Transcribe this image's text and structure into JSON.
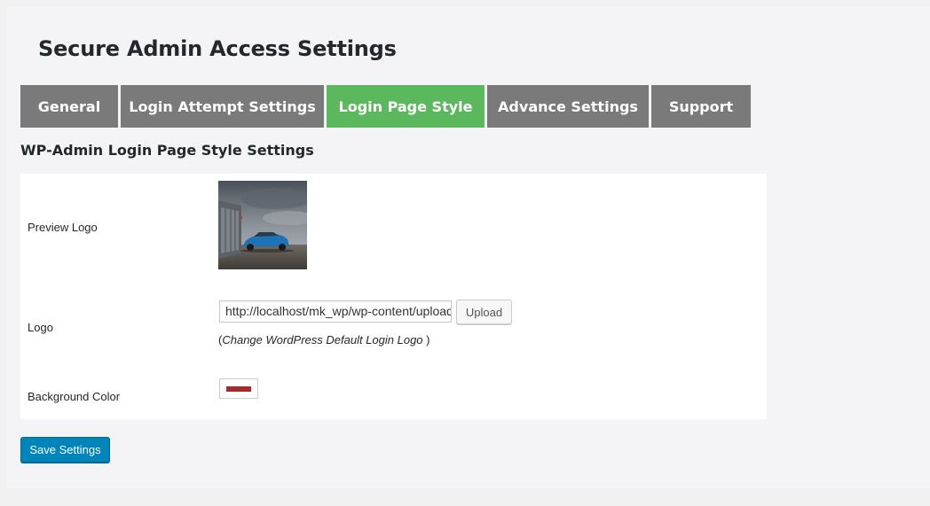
{
  "page": {
    "title": "Secure Admin Access Settings"
  },
  "tabs": [
    {
      "label": "General",
      "active": false
    },
    {
      "label": "Login Attempt Settings",
      "active": false
    },
    {
      "label": "Login Page Style",
      "active": true
    },
    {
      "label": "Advance Settings",
      "active": false
    },
    {
      "label": "Support",
      "active": false
    }
  ],
  "section": {
    "title": "WP-Admin Login Page Style Settings"
  },
  "form": {
    "preview_logo_label": "Preview Logo",
    "logo_label": "Logo",
    "logo_url_value": "http://localhost/mk_wp/wp-content/uploads/",
    "upload_label": "Upload",
    "hint_open": "(",
    "hint_text": "Change WordPress Default Login Logo",
    "hint_close": " )",
    "background_color_label": "Background Color",
    "background_color": "#a52a2a"
  },
  "actions": {
    "save_label": "Save Settings"
  },
  "colors": {
    "tab_default": "#7a7a7a",
    "tab_active": "#5cb85c",
    "primary_button": "#0085ba"
  }
}
